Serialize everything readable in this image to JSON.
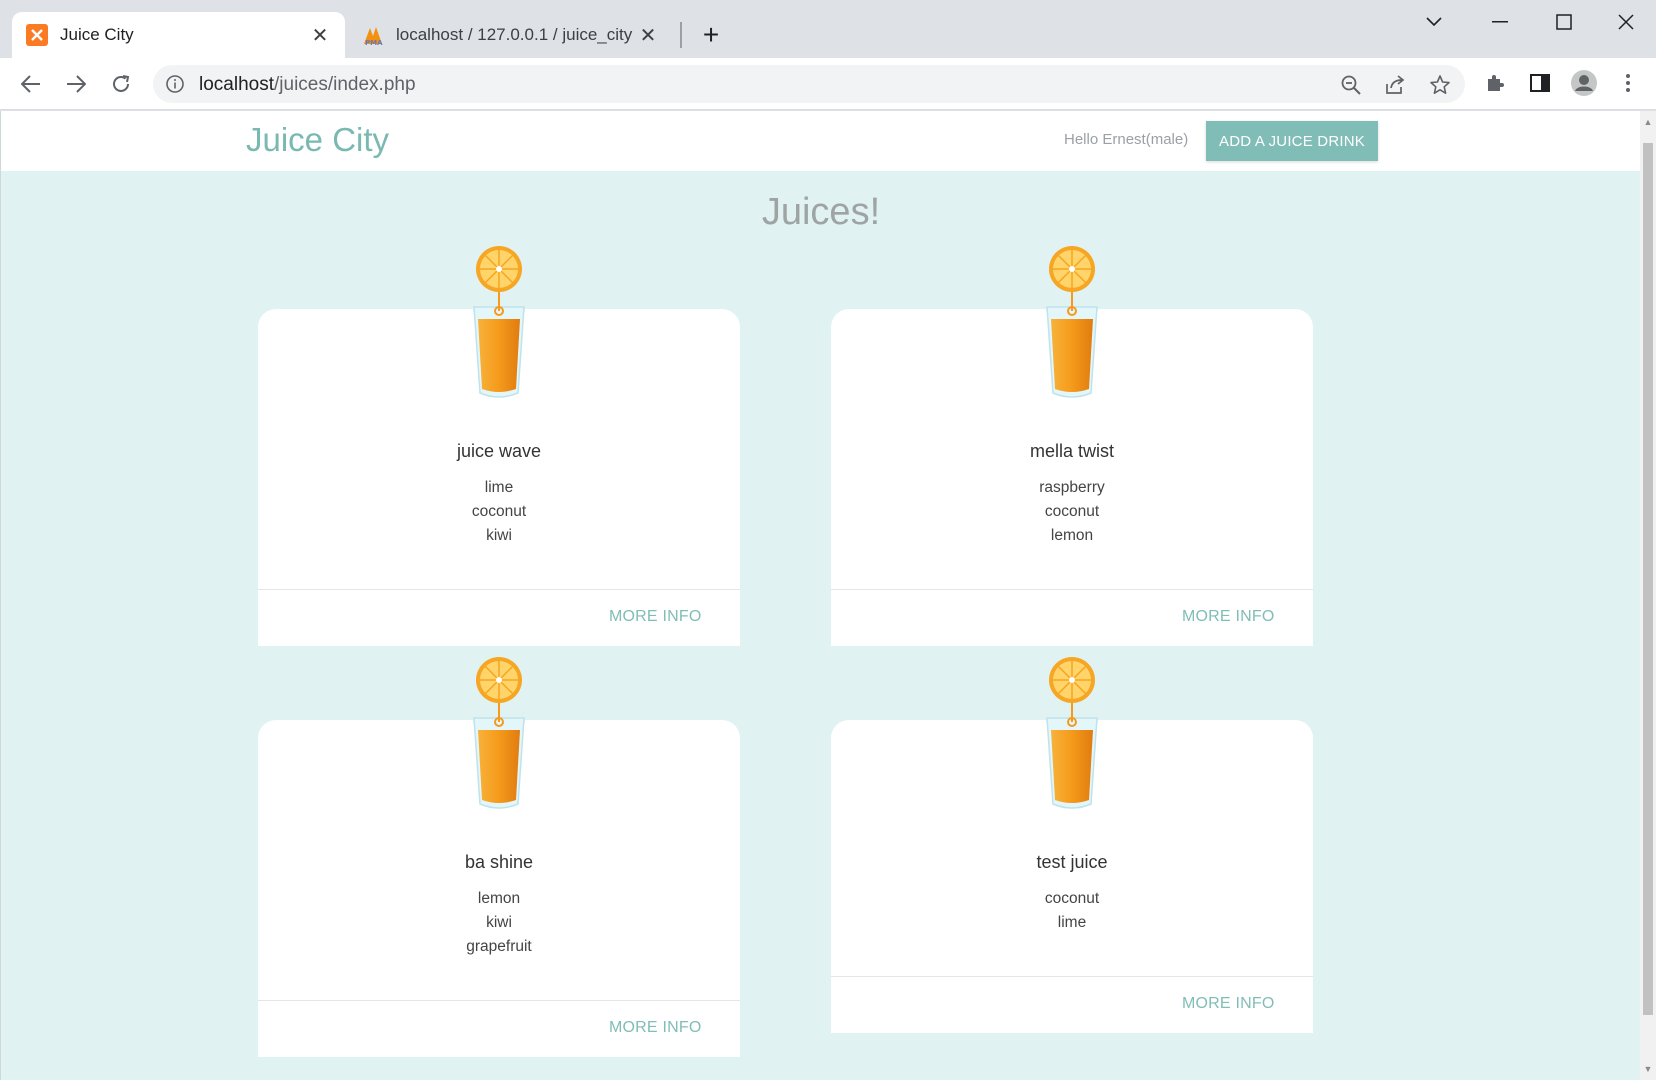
{
  "browser": {
    "tabs": [
      {
        "title": "Juice City",
        "icon": "xampp-icon",
        "active": true
      },
      {
        "title": "localhost / 127.0.0.1 / juice_city /",
        "icon": "phpmyadmin-icon",
        "active": false
      }
    ],
    "url_host": "localhost",
    "url_path": "/juices/index.php"
  },
  "site": {
    "brand": "Juice City",
    "greeting": "Hello Ernest(male)",
    "add_button": "ADD A JUICE DRINK",
    "heading": "Juices!"
  },
  "juices": [
    {
      "name": "juice wave",
      "ingredients": [
        "lime",
        "coconut",
        "kiwi"
      ],
      "more": "MORE INFO"
    },
    {
      "name": "mella twist",
      "ingredients": [
        "raspberry",
        "coconut",
        "lemon"
      ],
      "more": "MORE INFO"
    },
    {
      "name": "ba shine",
      "ingredients": [
        "lemon",
        "kiwi",
        "grapefruit"
      ],
      "more": "MORE INFO"
    },
    {
      "name": "test juice",
      "ingredients": [
        "coconut",
        "lime"
      ],
      "more": "MORE INFO"
    }
  ],
  "colors": {
    "accent": "#80bdb6",
    "brand": "#7ab8b2",
    "page_bg": "#e0f2f1",
    "juice": "#f39c12"
  }
}
